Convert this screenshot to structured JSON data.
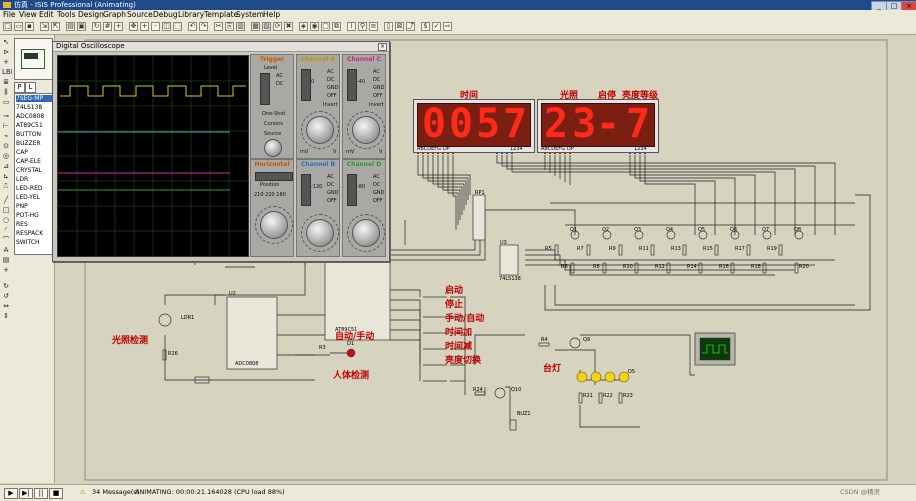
{
  "window": {
    "title": "仿真 - ISIS Professional (Animating)"
  },
  "menu": [
    "File",
    "View",
    "Edit",
    "Tools",
    "Design",
    "Graph",
    "Source",
    "Debug",
    "Library",
    "Template",
    "System",
    "Help"
  ],
  "device_panel": {
    "tabs": [
      "P",
      "L"
    ],
    "devices": [
      "7SEG-MP",
      "74LS138",
      "ADC0808",
      "AT89C51",
      "BUTTON",
      "BUZZER",
      "CAP",
      "CAP-ELE",
      "CRYSTAL",
      "LDR",
      "LED-RED",
      "LED-YEL",
      "PNP",
      "POT-HG",
      "RES",
      "RESPACK",
      "SWITCH"
    ],
    "selected_index": 0
  },
  "oscilloscope": {
    "title": "Digital Oscilloscope",
    "channels": {
      "a": {
        "label": "Channel A",
        "color": "#e8d21a",
        "position": "0",
        "volts_div": "20"
      },
      "b": {
        "label": "Channel B",
        "color": "#3a8fd8",
        "position": "-120",
        "volts_div": "20"
      },
      "c": {
        "label": "Channel C",
        "color": "#d03ab0",
        "position": "-40",
        "volts_div": "20"
      },
      "d": {
        "label": "Channel D",
        "color": "#30b040",
        "position": "-80",
        "volts_div": "20"
      }
    },
    "trigger": {
      "label": "Trigger",
      "level_label": "Level",
      "modes": "One-Shot",
      "cursors": "Cursors",
      "source": "Source"
    },
    "horizontal": {
      "label": "Horizontal",
      "position_label": "Position",
      "values": "210 220 180"
    },
    "switches": [
      "AC",
      "DC",
      "GND",
      "OFF",
      "Invert"
    ],
    "knob_labels": [
      "mV",
      "V"
    ]
  },
  "displays": {
    "time": {
      "label": "时间",
      "digits": [
        "0",
        "0",
        "5",
        "7"
      ]
    },
    "light": {
      "label": "光照",
      "value": "23"
    },
    "onoff": {
      "label": "启停"
    },
    "level": {
      "label": "亮度等级",
      "value": "7"
    },
    "sep": "-",
    "pin_labels": [
      "ABCDEFG",
      "DP",
      "1234"
    ]
  },
  "schematic": {
    "labels": {
      "light_detect": "光照检测",
      "start": "启动",
      "stop": "停止",
      "manual_auto": "手动/自动",
      "time_inc": "时间加",
      "time_dec": "时间减",
      "brightness_switch": "亮度切换",
      "auto_manual": "自动/手动",
      "human_detect": "人体检测",
      "lamp": "台灯"
    },
    "components": [
      "RP1",
      "U3",
      "U2",
      "U1",
      "LDR1",
      "R26",
      "R3",
      "D1",
      "R4",
      "Q9",
      "R24",
      "Q10",
      "BUZ1",
      "D5",
      "R22",
      "R23",
      "R21",
      "Q1",
      "Q2",
      "Q3",
      "Q4",
      "Q5",
      "Q6",
      "Q7",
      "Q8",
      "R5",
      "R6",
      "R7",
      "R8",
      "R9",
      "R10",
      "R11",
      "R12",
      "R13",
      "R14",
      "R15",
      "R16",
      "R17",
      "R18",
      "R19",
      "R20"
    ],
    "ic_labels": {
      "u1": "AT89C51",
      "u2": "ADC0808",
      "u3": "74LS138"
    }
  },
  "status": {
    "messages": "34 Message(s)",
    "sim_text": "ANIMATING: 00:00:21.164028 (CPU load 88%)",
    "watermark": "CSDN @精灵"
  },
  "colors": {
    "led_red": "#ff2a1a",
    "label_red": "#c00000",
    "canvas": "#d6d3bf",
    "wire": "#222222"
  }
}
